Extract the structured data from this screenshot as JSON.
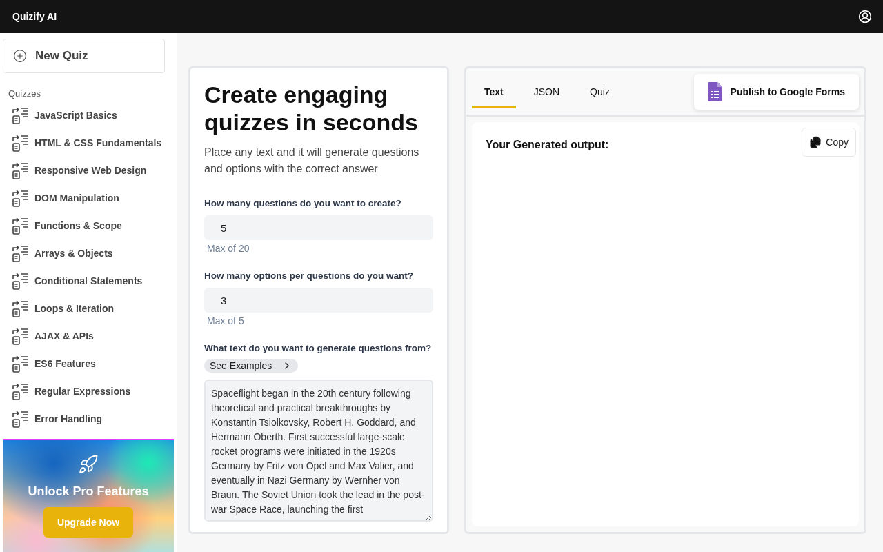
{
  "header": {
    "title": "Quizify AI"
  },
  "sidebar": {
    "new_button": "New Quiz",
    "section_label": "Quizzes",
    "items": [
      {
        "label": "JavaScript Basics"
      },
      {
        "label": "HTML & CSS Fundamentals"
      },
      {
        "label": "Responsive Web Design"
      },
      {
        "label": "DOM Manipulation"
      },
      {
        "label": "Functions & Scope"
      },
      {
        "label": "Arrays & Objects"
      },
      {
        "label": "Conditional Statements"
      },
      {
        "label": "Loops & Iteration"
      },
      {
        "label": "AJAX & APIs"
      },
      {
        "label": "ES6 Features"
      },
      {
        "label": "Regular Expressions"
      },
      {
        "label": "Error Handling"
      }
    ],
    "promo": {
      "title": "Unlock Pro Features",
      "button": "Upgrade Now"
    }
  },
  "form": {
    "title": "Create engaging quizzes in seconds",
    "subtitle": "Place any text and it will generate questions and options with the correct answer",
    "fields": [
      {
        "label": "How many questions do you want to create?",
        "value": "5",
        "hint": "Max of 20"
      },
      {
        "label": "How many options per questions do you want?",
        "value": "3",
        "hint": "Max of 5"
      }
    ],
    "text_label": "What text do you want to generate questions from?",
    "examples_button": "See Examples",
    "text_value": "Spaceflight began in the 20th century following theoretical and practical breakthroughs by Konstantin Tsiolkovsky, Robert H. Goddard, and Hermann Oberth. First successful large-scale rocket programs were initiated in the 1920s Germany by Fritz von Opel and Max Valier, and eventually in Nazi Germany by Wernher von Braun. The Soviet Union took the lead in the post-war Space Race, launching the first"
  },
  "output": {
    "tabs": [
      {
        "label": "Text",
        "selected": true
      },
      {
        "label": "JSON",
        "selected": false
      },
      {
        "label": "Quiz",
        "selected": false
      }
    ],
    "publish_button": "Publish to Google Forms",
    "heading": "Your Generated output:",
    "copy_button": "Copy"
  }
}
